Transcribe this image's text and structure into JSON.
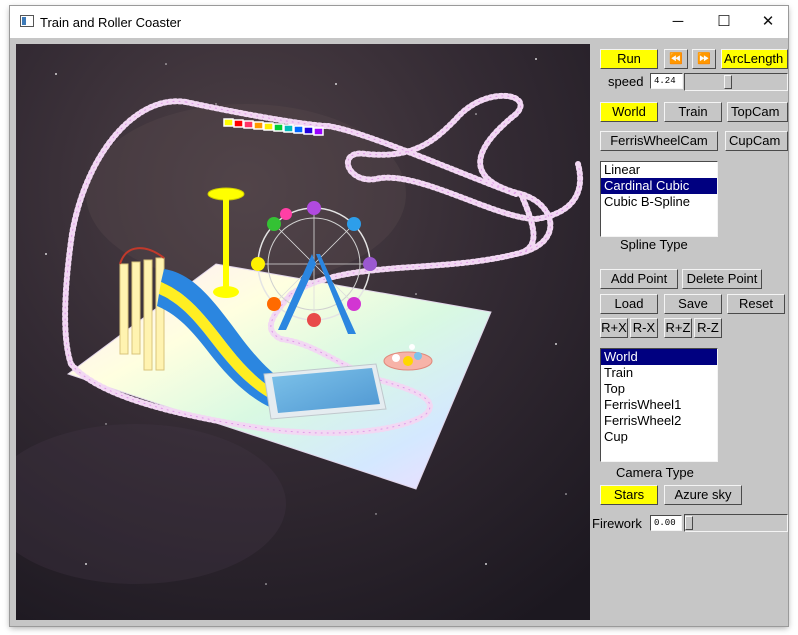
{
  "window": {
    "title": "Train and Roller Coaster",
    "minimize": "─",
    "maximize": "☐",
    "close": "✕"
  },
  "controls": {
    "run": "Run",
    "rewind": "⏪",
    "fast_forward": "⏩",
    "arclength": "ArcLength",
    "speed_label": "speed",
    "speed_value": "4.24",
    "speed_fraction": 0.42,
    "world": "World",
    "train": "Train",
    "topcam": "TopCam",
    "ferriswheelcam": "FerrisWheelCam",
    "cupcam": "CupCam",
    "spline_items": [
      "Linear",
      "Cardinal Cubic",
      "Cubic B-Spline"
    ],
    "spline_selected": 1,
    "spline_label": "Spline Type",
    "add_point": "Add Point",
    "delete_point": "Delete Point",
    "load": "Load",
    "save": "Save",
    "reset": "Reset",
    "rx_plus": "R+X",
    "rx_minus": "R-X",
    "rz_plus": "R+Z",
    "rz_minus": "R-Z",
    "camera_items": [
      "World",
      "Train",
      "Top",
      "FerrisWheel1",
      "FerrisWheel2",
      "Cup"
    ],
    "camera_selected": 0,
    "camera_label": "Camera Type",
    "stars": "Stars",
    "azure_sky": "Azure sky",
    "firework_label": "Firework",
    "firework_value": "0.00",
    "firework_fraction": 0.0
  },
  "colors": {
    "active_button": "#ffff00",
    "selection": "#000080",
    "panel": "#c6c6c6",
    "track": "#f3d9f5",
    "train_cars": [
      "#ffff00",
      "#ff0000",
      "#ff3366",
      "#ff9900",
      "#ffee00",
      "#00cc33",
      "#00bbbb",
      "#0066ff",
      "#2200dd",
      "#9900ff"
    ]
  }
}
